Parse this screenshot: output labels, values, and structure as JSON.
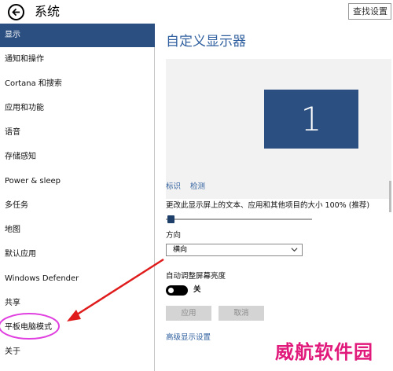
{
  "window": {
    "title": "系统",
    "search_placeholder": "查找设置"
  },
  "sidebar": {
    "items": [
      {
        "label": "显示"
      },
      {
        "label": "通知和操作"
      },
      {
        "label": "Cortana 和搜索"
      },
      {
        "label": "应用和功能"
      },
      {
        "label": "语音"
      },
      {
        "label": "存储感知"
      },
      {
        "label": "Power & sleep"
      },
      {
        "label": "多任务"
      },
      {
        "label": "地图"
      },
      {
        "label": "默认应用"
      },
      {
        "label": "Windows Defender"
      },
      {
        "label": "共享"
      },
      {
        "label": "平板电脑模式"
      },
      {
        "label": "关于"
      }
    ],
    "active_index": 0
  },
  "main": {
    "title": "自定义显示器",
    "monitor_number": "1",
    "identify_link": "标识",
    "detect_link": "检测",
    "scale_label": "更改此显示屏上的文本、应用和其他项目的大小 100% (推荐)",
    "scale_value": 0,
    "orientation_label": "方向",
    "orientation_value": "横向",
    "auto_brightness_label": "自动调整屏幕亮度",
    "auto_brightness_state": "关",
    "apply_button": "应用",
    "cancel_button": "取消",
    "advanced_link": "高级显示设置"
  },
  "annotation": {
    "arrow_color": "#e01b1b",
    "circle_color": "#e040e0",
    "highlighted_item": "平板电脑模式"
  },
  "watermark": "威航软件园",
  "colors": {
    "accent": "#2b4f81",
    "link": "#2f5f9e"
  }
}
